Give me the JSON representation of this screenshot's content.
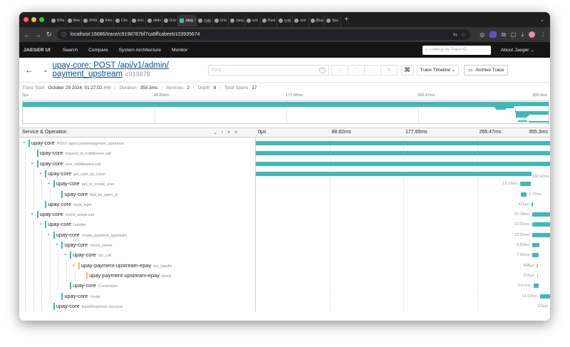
{
  "browser": {
    "tabs": [
      {
        "label": "Wha"
      },
      {
        "label": "New"
      },
      {
        "label": "AHdi"
      },
      {
        "label": "Intro"
      },
      {
        "label": "Che"
      },
      {
        "label": "doci"
      },
      {
        "label": "ahde"
      },
      {
        "label": "Univ"
      },
      {
        "label": "Jaeg",
        "active": true
      },
      {
        "label": "元组"
      },
      {
        "label": "Univ"
      },
      {
        "label": "Jaeg"
      },
      {
        "label": "rust"
      },
      {
        "label": "Rust"
      },
      {
        "label": "分布"
      },
      {
        "label": "rust"
      },
      {
        "label": "[Bug"
      },
      {
        "label": "Spa"
      }
    ],
    "new_tab": "+",
    "url": "localhost:16686/trace/c9198787bf7ca9ffcabeeb103935674"
  },
  "jaeger_nav": {
    "logo": "JAEGER UI",
    "items": [
      "Search",
      "Compare",
      "System Architecture",
      "Monitor"
    ],
    "lookup_placeholder": "Lookup by Trace ID...",
    "about": "About Jaeger ⌄"
  },
  "trace": {
    "title_line1": "upay-core: POST /api/v1/admin/",
    "title_line2": "payment_upstream",
    "short_id": "c919878",
    "find_placeholder": "Find...",
    "timeline_label": "Trace Timeline ⌄",
    "archive_label": "Archive Trace",
    "summary": {
      "start_label": "Trace Start",
      "start_value": "October 29 2024, 01:27:02",
      "start_ms": ".446",
      "duration_label": "Duration",
      "duration_value": "355.3ms",
      "services_label": "Services",
      "services_value": "2",
      "depth_label": "Depth",
      "depth_value": "8",
      "spans_label": "Total Spans",
      "spans_value": "17"
    }
  },
  "minimap": {
    "ticks": [
      "0μs",
      "88.82ms",
      "177.65ms",
      "266.47ms",
      "355.3ms"
    ]
  },
  "span_table": {
    "header_left": "Service & Operation",
    "header_icons": [
      "⌄",
      "›",
      "»",
      "»"
    ],
    "ticks": [
      "0μs",
      "88.82ms",
      "177.65ms",
      "266.47ms",
      "355.3ms"
    ],
    "total_ms": 355.3,
    "colors": {
      "upay-core": "#3fb9b6",
      "upay-payment-upstream-epay": "#e6c768"
    },
    "rows": [
      {
        "depth": 0,
        "chev": "⌄",
        "service": "upay-core",
        "op": "POST /api/v1/admin/payment_upstream",
        "start_ms": 0,
        "dur_ms": 355.3,
        "dur_label": "",
        "root": true
      },
      {
        "depth": 1,
        "chev": "",
        "service": "upay-core",
        "op": "request_id_middleware.call",
        "start_ms": 0,
        "dur_ms": 355.3,
        "dur_label": "",
        "root": true
      },
      {
        "depth": 1,
        "chev": "⌄",
        "service": "upay-core",
        "op": "user_middleware.call",
        "start_ms": 0,
        "dur_ms": 355.3,
        "dur_label": ""
      },
      {
        "depth": 2,
        "chev": "⌄",
        "service": "upay-core",
        "op": "get_user_by_token",
        "start_ms": 0,
        "dur_ms": 332.42,
        "dur_label": "332.42ms"
      },
      {
        "depth": 3,
        "chev": "⌄",
        "service": "upay-core",
        "op": "get_or_create_user",
        "start_ms": 318.5,
        "dur_ms": 13.13,
        "dur_label": "13.13ms"
      },
      {
        "depth": 4,
        "chev": "",
        "service": "upay-core",
        "op": "find_by_open_id",
        "start_ms": 319.5,
        "dur_ms": 6.72,
        "dur_label": "6.72ms"
      },
      {
        "depth": 2,
        "chev": "",
        "service": "upay-core",
        "op": "must_login",
        "start_ms": 332.5,
        "dur_ms": 0.416,
        "dur_label": "416μs"
      },
      {
        "depth": 1,
        "chev": "⌄",
        "service": "upay-core",
        "op": "check_scope.call",
        "start_ms": 332.9,
        "dur_ms": 22.18,
        "dur_label": "22.18ms"
      },
      {
        "depth": 2,
        "chev": "⌄",
        "service": "upay-core",
        "op": "handler",
        "start_ms": 333.0,
        "dur_ms": 22.02,
        "dur_label": "22.02ms"
      },
      {
        "depth": 3,
        "chev": "⌄",
        "service": "upay-core",
        "op": "create_payment_upstream",
        "start_ms": 333.1,
        "dur_ms": 22.22,
        "dur_label": "22.22ms"
      },
      {
        "depth": 4,
        "chev": "⌄",
        "service": "upay-core",
        "op": "check_server",
        "start_ms": 333.1,
        "dur_ms": 8.83,
        "dur_label": "8.83ms"
      },
      {
        "depth": 5,
        "chev": "⌄",
        "service": "upay-core",
        "op": "rpc_call",
        "start_ms": 333.2,
        "dur_ms": 7.55,
        "dur_label": "7.55ms"
      },
      {
        "depth": 6,
        "chev": "⌄",
        "service": "upay-payment-upstream-epay",
        "op": "rpc_handle",
        "start_ms": 338.5,
        "dur_ms": 0.548,
        "dur_label": "548μs"
      },
      {
        "depth": 7,
        "chev": "",
        "service": "upay-payment-upstream-epay",
        "op": "check",
        "start_ms": 338.6,
        "dur_ms": 0.31,
        "dur_label": "310μs"
      },
      {
        "depth": 5,
        "chev": "",
        "service": "upay-core",
        "op": "Connection",
        "start_ms": 334.5,
        "dur_ms": 6.51,
        "dur_label": "6.51ms"
      },
      {
        "depth": 4,
        "chev": "",
        "service": "upay-core",
        "op": "create",
        "start_ms": 342.0,
        "dur_ms": 13.13,
        "dur_label": "13.13ms"
      },
      {
        "depth": 3,
        "chev": "",
        "service": "upay-core",
        "op": "BaseResponse::success",
        "start_ms": 355.1,
        "dur_ms": 0.133,
        "dur_label": "133μs"
      }
    ]
  }
}
